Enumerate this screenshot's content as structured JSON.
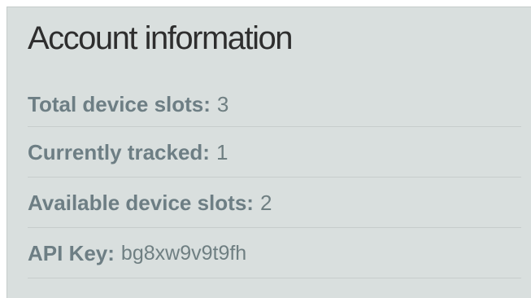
{
  "account": {
    "title": "Account information",
    "rows": [
      {
        "label": "Total device slots:",
        "value": "3"
      },
      {
        "label": "Currently tracked:",
        "value": "1"
      },
      {
        "label": "Available device slots:",
        "value": "2"
      },
      {
        "label": "API Key:",
        "value": "bg8xw9v9t9fh"
      }
    ]
  },
  "colors": {
    "panel_background": "#d9dfde",
    "title_text": "#2e2e2e",
    "row_text": "#6f7f82",
    "divider": "#c7cdcc"
  }
}
